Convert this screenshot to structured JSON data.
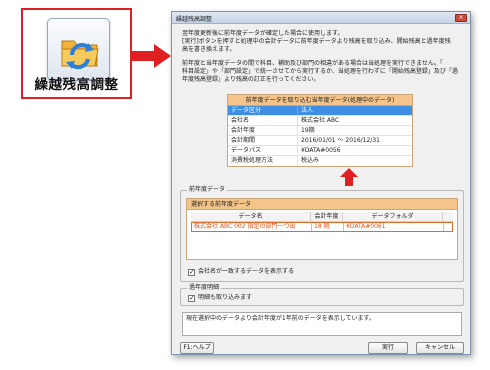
{
  "tool": {
    "label": "繰越残高調整",
    "icon": "carry-forward-folder-icon"
  },
  "dialog": {
    "title": "繰越残高調整",
    "close_label": "×",
    "desc1": "翌年度更新後に前年度データが確定した場合に使用します。",
    "desc2": "[実行]ボタンを押すと処理中の会計データに前年度データより残高を取り込み、開始残高と過年度残",
    "desc3": "高を書き換えます。",
    "desc4": "前年度と当年度データの間で科目、補助及び部門の相違がある場合は当処理を実行できません。「",
    "desc5": "科目設定」や「部門設定」で統一させてから実行するか、当処理を行わずに「開始残高登録」及び「過",
    "desc6": "年度残高登録」より残高の訂正を行ってください。",
    "current_table": {
      "header": "前年度データを取り込む当年度データ(処理中のデータ)",
      "rows": [
        {
          "key": "データ区分",
          "value": "法人"
        },
        {
          "key": "会社名",
          "value": "株式会社 ABC"
        },
        {
          "key": "会計年度",
          "value": "19期"
        },
        {
          "key": "会計期間",
          "value": "2016/01/01 ～ 2016/12/31"
        },
        {
          "key": "データパス",
          "value": "¥DATA#0056"
        },
        {
          "key": "消費税処理方法",
          "value": "税込み"
        }
      ]
    },
    "prev_group": {
      "legend": "前年度データ",
      "panel_head": "選択する前年度データ",
      "columns": [
        "データ名",
        "会計年度",
        "データフォルダ"
      ],
      "row": [
        "株式会社 ABC 002 指定の部門一つ出",
        "18 期",
        "¥DATA#0061"
      ],
      "checkbox_label": "会社名が一致するデータを表示する"
    },
    "past_group": {
      "legend": "過年度明細",
      "checkbox_label": "明細も取り込みます"
    },
    "info_text": "現在選択中のデータより会計年度が1年前のデータを表示しています。",
    "buttons": {
      "help": "F1:ヘルプ",
      "run": "実行",
      "cancel": "キャンセル"
    }
  },
  "colors": {
    "highlight": "#e02020",
    "table_header": "#f4c48a",
    "selection": "#3e8fe4"
  }
}
